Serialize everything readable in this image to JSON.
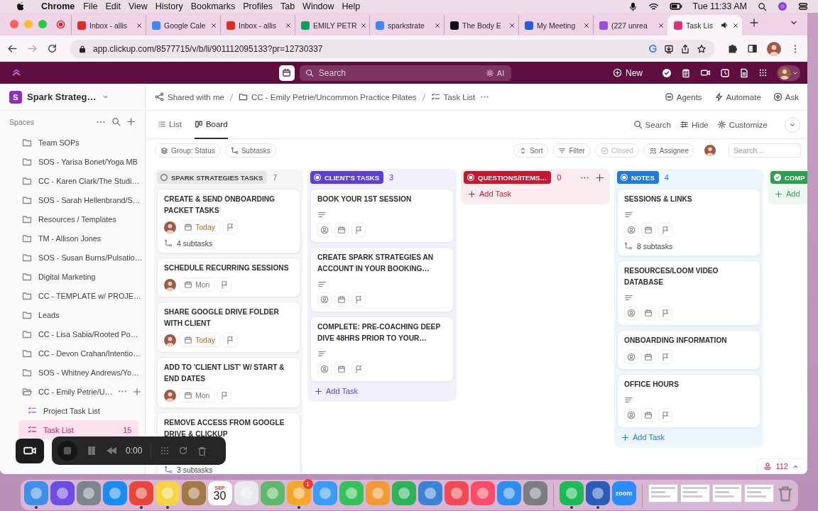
{
  "menu_bar": {
    "app": "Chrome",
    "menus": [
      "File",
      "Edit",
      "View",
      "History",
      "Bookmarks",
      "Profiles",
      "Tab",
      "Window",
      "Help"
    ],
    "clock": "Tue 11:33 AM"
  },
  "browser": {
    "tabs": [
      {
        "title": "Inbox - allis",
        "color": "#d93025",
        "selected": false
      },
      {
        "title": "Google Cale",
        "color": "#4285f4",
        "selected": false
      },
      {
        "title": "Inbox - allis",
        "color": "#d93025",
        "selected": false
      },
      {
        "title": "EMILY PETR",
        "color": "#0f9d58",
        "selected": false
      },
      {
        "title": "sparkstrate",
        "color": "#4285f4",
        "selected": false
      },
      {
        "title": "The Body E",
        "color": "#111111",
        "selected": false
      },
      {
        "title": "My Meeting",
        "color": "#2d5bd8",
        "selected": false
      },
      {
        "title": "(227 unrea",
        "color": "#9b4fd9",
        "selected": false
      },
      {
        "title": "Task Lis",
        "color": "#e0307a",
        "selected": true
      }
    ],
    "url": "app.clickup.com/8577715/v/b/li/901112095133?pr=12730337"
  },
  "top_bar": {
    "search_placeholder": "Search",
    "ai_label": "AI",
    "new_label": "New"
  },
  "sidebar": {
    "workspace_initial": "S",
    "workspace": "Spark Strateg…",
    "section": "Spaces",
    "items": [
      {
        "label": "Team SOPs",
        "expanded": false
      },
      {
        "label": "SOS - Yarisa Bonet/Yoga MB",
        "expanded": false
      },
      {
        "label": "CC - Karen Clark/The Studi…",
        "expanded": false
      },
      {
        "label": "SOS - Sarah Hellenbrand/S…",
        "expanded": false
      },
      {
        "label": "Resources / Templates",
        "expanded": false
      },
      {
        "label": "TM - Allison Jones",
        "expanded": false
      },
      {
        "label": "SOS - Susan Burns/Pulsatio…",
        "expanded": false
      },
      {
        "label": "Digital Marketing",
        "expanded": false
      },
      {
        "label": "CC - TEMPLATE w/ PROJE…",
        "expanded": false
      },
      {
        "label": "Leads",
        "expanded": false
      },
      {
        "label": "CC - Lisa Sabia/Rooted Po…",
        "expanded": false
      },
      {
        "label": "CC - Devon Crahan/Intentio…",
        "expanded": false
      },
      {
        "label": "SOS - Whitney Andrews/Yo…",
        "expanded": false
      },
      {
        "label": "CC - Emily Petrie/U…",
        "expanded": true,
        "children": [
          {
            "label": "Project Task List",
            "selected": false
          },
          {
            "label": "Task List",
            "selected": true,
            "count": "15"
          }
        ]
      }
    ]
  },
  "breadcrumb": [
    "Shared with me",
    "CC - Emily Petrie/Uncommon Practice Pilates",
    "Task List"
  ],
  "header_actions": [
    "Agents",
    "Automate",
    "Ask"
  ],
  "view_tabs": [
    {
      "label": "List",
      "selected": false
    },
    {
      "label": "Board",
      "selected": true
    }
  ],
  "view_actions": [
    "Search",
    "Hide",
    "Customize"
  ],
  "toolbar": {
    "left": [
      "Group: Status",
      "Subtasks"
    ],
    "right": [
      {
        "label": "Sort",
        "disabled": false
      },
      {
        "label": "Filter",
        "disabled": false
      },
      {
        "label": "Closed",
        "disabled": true
      },
      {
        "label": "Assignee",
        "disabled": false
      }
    ],
    "search_placeholder": "Search..."
  },
  "board": {
    "columns": [
      {
        "name": "SPARK STRATEGIES TASKS",
        "count": "7",
        "kind": "open",
        "color": "#87909e",
        "actions_visible": false,
        "cards": [
          {
            "title": "CREATE & SEND ONBOARDING PACKET TASKS",
            "description": false,
            "kind": "assigned",
            "due": {
              "label": "Today",
              "urgent": true
            },
            "subtasks": "4 subtasks"
          },
          {
            "title": "SCHEDULE RECURRING SESSIONS",
            "description": false,
            "kind": "assigned",
            "due": {
              "label": "Mon",
              "urgent": false
            }
          },
          {
            "title": "SHARE GOOGLE DRIVE FOLDER WITH CLIENT",
            "description": false,
            "kind": "assigned",
            "due": {
              "label": "Today",
              "urgent": true
            }
          },
          {
            "title": "ADD TO 'CLIENT LIST' W/ START & END DATES",
            "description": false,
            "kind": "assigned",
            "due": {
              "label": "Mon",
              "urgent": false
            }
          },
          {
            "title": "REMOVE ACCESS FROM GOOGLE DRIVE & CLICKUP",
            "description": false,
            "subtasks": "3 subtasks"
          }
        ]
      },
      {
        "name": "CLIENT'S TASKS",
        "count": "3",
        "kind": "active",
        "color": "#5b3fd6",
        "actions_visible": false,
        "cards": [
          {
            "title": "BOOK YOUR 1ST SESSION",
            "description": true,
            "kind": "unassigned"
          },
          {
            "title": "CREATE SPARK STRATEGIES AN ACCOUNT IN YOUR BOOKING…",
            "description": true,
            "kind": "unassigned"
          },
          {
            "title": "COMPLETE: PRE-COACHING DEEP DIVE 48HRS PRIOR TO YOUR…",
            "description": true,
            "kind": "unassigned"
          }
        ],
        "add_task": "Add Task"
      },
      {
        "name": "QUESTIONS/ITEMS…",
        "count": "0",
        "kind": "active",
        "color": "#c8162f",
        "actions_visible": true,
        "add_task": "Add Task"
      },
      {
        "name": "NOTES",
        "count": "4",
        "kind": "active",
        "color": "#1f7ae0",
        "actions_visible": false,
        "cards": [
          {
            "title": "SESSIONS & LINKS",
            "description": true,
            "kind": "unassigned",
            "subtasks": "8 subtasks"
          },
          {
            "title": "RESOURCES/LOOM VIDEO DATABASE",
            "description": true,
            "kind": "unassigned"
          },
          {
            "title": "ONBOARDING INFORMATION",
            "description": false,
            "kind": "unassigned"
          },
          {
            "title": "OFFICE HOURS",
            "description": true,
            "kind": "unassigned"
          }
        ],
        "add_task": "Add Task"
      },
      {
        "name": "COMP",
        "kind": "done",
        "color": "#2e9e4f",
        "add_task": "Add"
      }
    ]
  },
  "recorder": {
    "time": "0:00"
  },
  "status": {
    "count": "112"
  },
  "dock": [
    {
      "kind": "app",
      "color": "#3d8fe8",
      "running": true
    },
    {
      "kind": "app",
      "color": "#6b4de6",
      "running": false
    },
    {
      "kind": "app",
      "color": "#7d8590",
      "running": false
    },
    {
      "kind": "app",
      "color": "#1a8cf0",
      "running": false
    },
    {
      "kind": "app",
      "color": "#e8453c",
      "running": true
    },
    {
      "kind": "app",
      "color": "#f5d547",
      "running": true
    },
    {
      "kind": "app",
      "color": "#a57848",
      "running": false
    },
    {
      "kind": "calendar",
      "month": "SEP",
      "day": "30",
      "running": false
    },
    {
      "kind": "app",
      "color": "#e9e9ee",
      "running": false
    },
    {
      "kind": "app",
      "color": "#5fb86b",
      "running": false
    },
    {
      "kind": "app",
      "color": "#f4a72c",
      "badge": "1",
      "running": true
    },
    {
      "kind": "app",
      "color": "#3a9cf5",
      "running": false
    },
    {
      "kind": "app",
      "color": "#35c25a",
      "running": false
    },
    {
      "kind": "app",
      "color": "#f29a35",
      "running": false
    },
    {
      "kind": "app",
      "color": "#2fb35a",
      "running": false
    },
    {
      "kind": "app",
      "color": "#3c83d8",
      "running": false
    },
    {
      "kind": "app",
      "color": "#f04a55",
      "running": false
    },
    {
      "kind": "app",
      "color": "#fa4c6a",
      "running": false
    },
    {
      "kind": "app",
      "color": "#2f8df2",
      "running": false
    },
    {
      "kind": "app",
      "color": "#7a7d82",
      "running": false
    },
    {
      "kind": "separator"
    },
    {
      "kind": "app",
      "color": "#1db954",
      "running": true
    },
    {
      "kind": "app",
      "color": "#2b5cb8",
      "running": true
    },
    {
      "kind": "app",
      "color": "#2d8cff",
      "label": "zoom",
      "running": false
    },
    {
      "kind": "separator"
    },
    {
      "kind": "window"
    },
    {
      "kind": "window"
    },
    {
      "kind": "window"
    },
    {
      "kind": "window"
    },
    {
      "kind": "trash"
    }
  ]
}
